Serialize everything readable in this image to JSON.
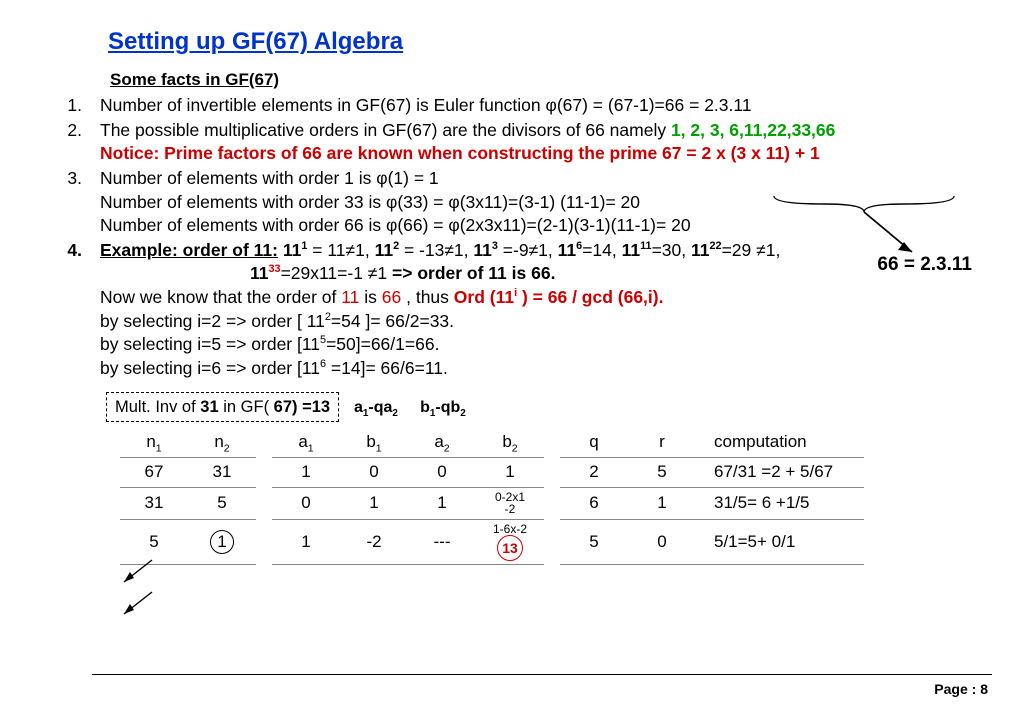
{
  "title": "Setting up GF(67) Algebra",
  "subhead": "Some facts in GF(67)",
  "pt1": "Number of invertible elements in GF(67) is Euler function ",
  "pt1b": "φ(67) = (67-1)=66 = 2.3.11",
  "pt2": "The possible multiplicative orders in GF(67) are the divisors of 66  namely ",
  "pt2g": "1, 2, 3, 6,11,22,33,66",
  "pt2r": "Notice: Prime factors of 66 are known when constructing the prime 67 =  2 x (3 x 11)  + 1",
  "pt3a": "Number of elements with order 1 is ",
  "pt3a2": "φ(1) = 1",
  "pt3b": "Number of elements with order 33 is ",
  "pt3b2": "φ(33) = φ(3x11)=(3-1) (11-1)= 20",
  "pt3c": "Number of elements with order 66 is ",
  "pt3c2": "φ(66) = φ(2x3x11)=(2-1)(3-1)(11-1)= 20",
  "ex_lead": "Example: order of 11:",
  "ex_now1": "Now we know that the order of  ",
  "ex_11": "11",
  "ex_is": "  is  ",
  "ex_66": "66",
  "ex_thus": "  , thus  ",
  "ex_ord": "Ord (11",
  "ex_ord2": " ) = 66 / gcd (66,i).",
  "ex_bi2": "by selecting i=2 => order [ 11",
  "ex_bi2b": "=54 ]= 66/2=33.",
  "ex_bi5": "by selecting i=5 => order [11",
  "ex_bi5b": "=50]=66/1=66.",
  "ex_bi6": "by selecting i=6 => order [11",
  "ex_bi6b": " =14]= 66/6=11.",
  "inv_label_a": "Mult. Inv of ",
  "inv_label_b": "31",
  "inv_label_c": " in GF( ",
  "inv_label_d": "67) =13",
  "lab1": "a₁-qa₂",
  "lab2": "b₁-qb₂",
  "annot": "66 = 2.3.11",
  "footer_a": "Page :  ",
  "footer_b": "8",
  "hdr": {
    "n1": "n",
    "n2": "n",
    "a1": "a",
    "b1": "b",
    "a2": "a",
    "b2": "b",
    "q": "q",
    "r": "r",
    "comp": "computation"
  },
  "row1": {
    "n1": "67",
    "n2": "31",
    "a1": "1",
    "b1": "0",
    "a2": "0",
    "b2": "1",
    "q": "2",
    "r": "5",
    "comp": "67/31 =2 + 5/67"
  },
  "row2": {
    "n1": "31",
    "n2": "5",
    "a1": "0",
    "b1": "1",
    "a2": "1",
    "b2a": "0-2x1",
    "b2b": "-2",
    "q": "6",
    "r": "1",
    "comp": "31/5= 6 +1/5"
  },
  "row3": {
    "n1": "5",
    "n2": "1",
    "a1": "1",
    "b1": "-2",
    "a2": "---",
    "b2a": "1-6x-2",
    "b2b": "13",
    "q": "5",
    "r": "0",
    "comp": "5/1=5+ 0/1"
  },
  "chart_data": {
    "type": "table",
    "title": "Extended Euclid: multiplicative inverse of 31 in GF(67) = 13",
    "columns": [
      "n1",
      "n2",
      "a1",
      "b1",
      "a2",
      "b2",
      "q",
      "r",
      "computation"
    ],
    "rows": [
      [
        67,
        31,
        1,
        0,
        0,
        1,
        2,
        5,
        "67/31 = 2 + 5/67"
      ],
      [
        31,
        5,
        0,
        1,
        1,
        "0-2x1 = -2",
        6,
        1,
        "31/5 = 6 + 1/5"
      ],
      [
        5,
        1,
        1,
        -2,
        "---",
        "1-6x-2 = 13",
        5,
        0,
        "5/1 = 5 + 0/1"
      ]
    ]
  }
}
